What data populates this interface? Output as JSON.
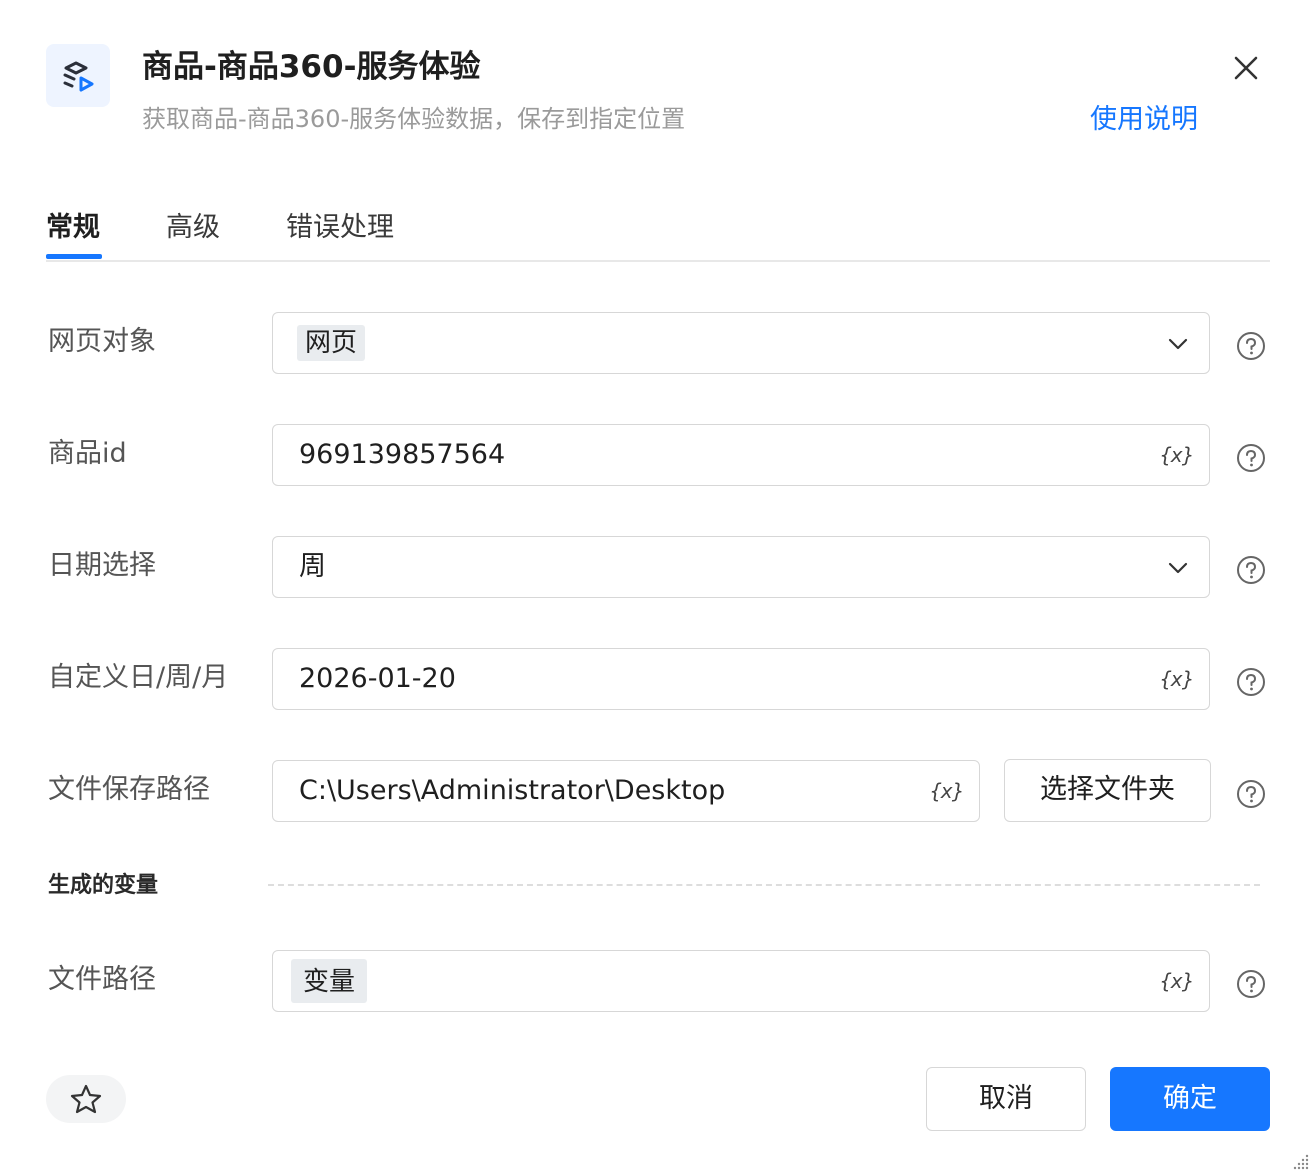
{
  "header": {
    "title": "商品-商品360-服务体验",
    "subtitle": "获取商品-商品360-服务体验数据，保存到指定位置",
    "help_link": "使用说明",
    "app_icon": "data-flow-icon",
    "close_icon": "close-icon"
  },
  "tabs": [
    {
      "label": "常规",
      "active": true
    },
    {
      "label": "高级",
      "active": false
    },
    {
      "label": "错误处理",
      "active": false
    }
  ],
  "form": {
    "web_object": {
      "label": "网页对象",
      "tag": "网页",
      "icon": "chevron-down-icon"
    },
    "product_id": {
      "label": "商品id",
      "value": "969139857564",
      "icon": "variable-icon"
    },
    "date_select": {
      "label": "日期选择",
      "value": "周",
      "icon": "chevron-down-icon"
    },
    "custom_date": {
      "label": "自定义日/周/月",
      "value": "2026-01-20",
      "icon": "variable-icon"
    },
    "save_path": {
      "label": "文件保存路径",
      "value": "C:\\Users\\Administrator\\Desktop",
      "button": "选择文件夹",
      "icon": "variable-icon"
    },
    "var_icon_text": "{x}"
  },
  "output": {
    "section_title": "生成的变量",
    "file_path": {
      "label": "文件路径",
      "tag": "变量",
      "icon": "variable-icon"
    }
  },
  "footer": {
    "favorite_icon": "star-icon",
    "cancel": "取消",
    "ok": "确定"
  },
  "colors": {
    "accent": "#1677ff",
    "border": "#d7d7d7",
    "tag_bg": "#e9ecef",
    "muted_text": "#9a9a9a"
  }
}
